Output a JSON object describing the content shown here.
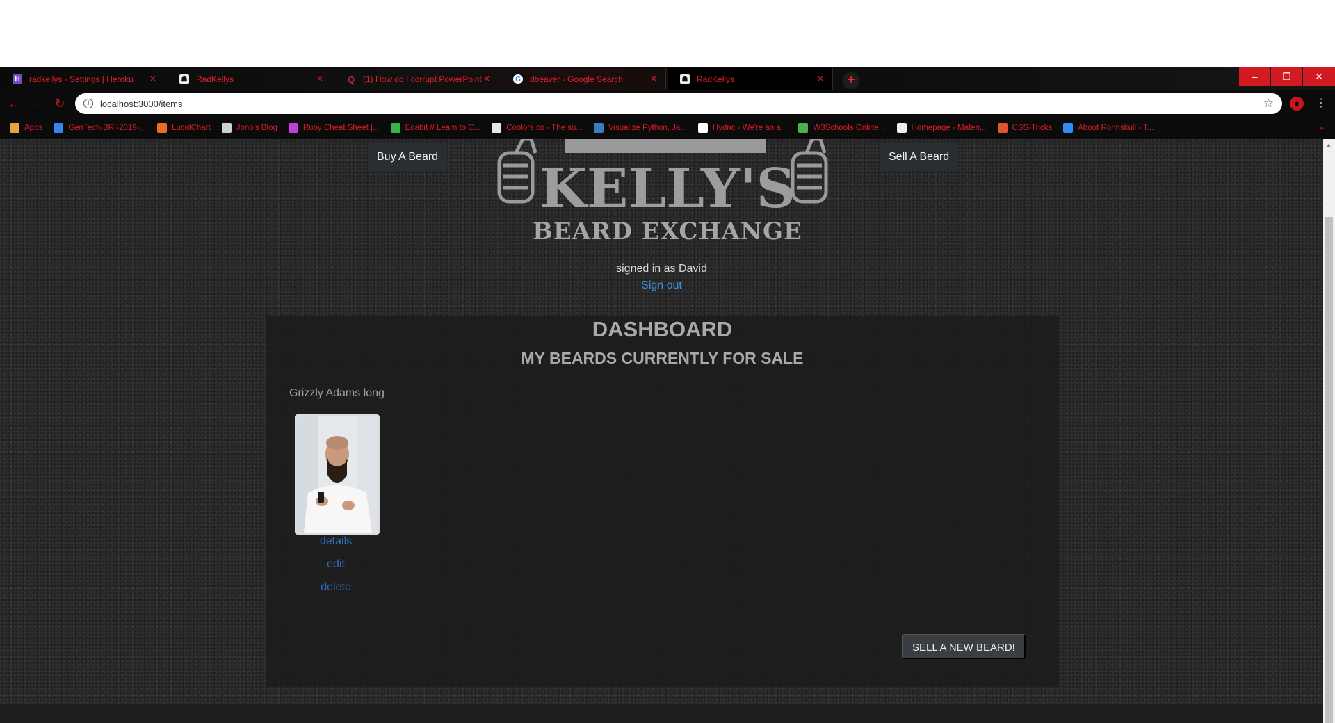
{
  "browser": {
    "tabs": [
      {
        "title": "radkellys - Settings | Heroku",
        "icon": "heroku-icon"
      },
      {
        "title": "RadKellys",
        "icon": "radkellys-icon"
      },
      {
        "title": "(1) How do I corrupt PowerPoint",
        "icon": "quora-icon"
      },
      {
        "title": "dbeaver - Google Search",
        "icon": "google-icon"
      },
      {
        "title": "RadKellys",
        "icon": "radkellys-icon"
      }
    ],
    "new_tab": "+",
    "window_buttons": {
      "minimize": "–",
      "restore": "❐",
      "close": "✕"
    },
    "url": "localhost:3000/items",
    "bookmarks": [
      {
        "label": "Apps",
        "icon": "apps-grid-icon",
        "color": "#e8a33d"
      },
      {
        "label": "GenTech-BRI-2019-...",
        "icon": "a-icon",
        "color": "#3b82f6"
      },
      {
        "label": "LucidChart",
        "icon": "lucidchart-icon",
        "color": "#f26b21"
      },
      {
        "label": "Jono's Blog",
        "icon": "wordpress-icon",
        "color": "#cfcfcf"
      },
      {
        "label": "Ruby Cheat Sheet |...",
        "icon": "ruby-icon",
        "color": "#c43cd9"
      },
      {
        "label": "Edabit // Learn to C...",
        "icon": "edabit-icon",
        "color": "#37b24d"
      },
      {
        "label": "Coolors.co - The su...",
        "icon": "coolors-icon",
        "color": "#e6e6e6"
      },
      {
        "label": "Visualize Python, Ja...",
        "icon": "python-icon",
        "color": "#3b7bbf"
      },
      {
        "label": "Hydric - We're an a...",
        "icon": "h-icon",
        "color": "#ffffff"
      },
      {
        "label": "W3Schools Online...",
        "icon": "w3schools-icon",
        "color": "#4caf50"
      },
      {
        "label": "Homepage - Materi...",
        "icon": "page-icon",
        "color": "#eeeeee"
      },
      {
        "label": "CSS-Tricks",
        "icon": "csstricks-icon",
        "color": "#e2552a"
      },
      {
        "label": "About Ronnskull - T...",
        "icon": "globe-icon",
        "color": "#2f8df5"
      }
    ],
    "bookmarks_more": "»"
  },
  "header": {
    "buy_label": "Buy A Beard",
    "sell_label": "Sell A Beard",
    "logo": {
      "line1": "KELLY'S",
      "line2": "BEARD EXCHANGE"
    }
  },
  "session": {
    "signed_in": "signed in as David",
    "sign_out": "Sign out"
  },
  "dashboard": {
    "title": "DASHBOARD",
    "subtitle": "MY BEARDS CURRENTLY FOR SALE",
    "items": [
      {
        "name": "Grizzly Adams long",
        "details": "details",
        "edit": "edit",
        "delete": "delete"
      }
    ],
    "sell_new": "SELL A NEW BEARD!"
  },
  "colors": {
    "tab_text": "#e0202a",
    "link": "#2c6fb8",
    "page_bg": "#2b2b2b",
    "panel_bg": "#1c1c1c"
  }
}
